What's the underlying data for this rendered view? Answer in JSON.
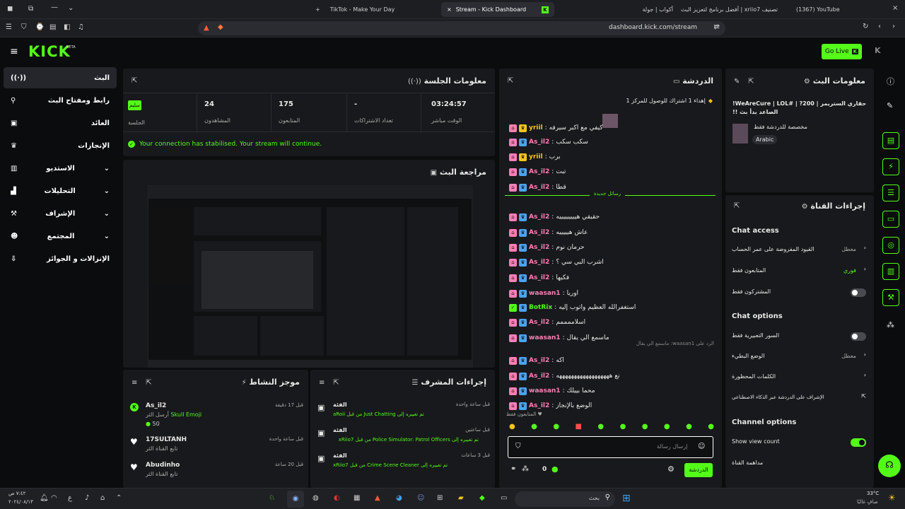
{
  "browser": {
    "tabs": [
      "(1367) YouTube",
      "تصنيف xriio7 | أفضل برنامج لتعزيز البث",
      "أكواب | جولة",
      "Stream - Kick Dashboard",
      "TikTok - Make Your Day"
    ],
    "url": "dashboard.kick.com/stream"
  },
  "header": {
    "logo": "KICK",
    "beta": "BETA",
    "go_live": "Go Live"
  },
  "sidebar": {
    "items": [
      "البث",
      "رابط ومفتاح البث",
      "العائد",
      "الإنجازات",
      "الاستديو",
      "التحليلات",
      "الإشراف",
      "المجتمع",
      "الإنزالات و الجوائز"
    ]
  },
  "session": {
    "title": "معلومات الجلسة",
    "status_badge": "سليم",
    "status_label": "الجلسة",
    "stats": [
      {
        "value": "24",
        "label": "المشاهدون"
      },
      {
        "value": "175",
        "label": "المتابعون"
      },
      {
        "value": "-",
        "label": "تعداد الاشتراكات"
      },
      {
        "value": "03:24:57",
        "label": "الوقت مباشر"
      }
    ],
    "notice": "Your connection has stabilised. Your stream will continue."
  },
  "preview": {
    "title": "مراجعة البث"
  },
  "activity": {
    "title": "موجز النشاط",
    "items": [
      {
        "user": "As_il2",
        "desc": "أرسل الثر",
        "gift": "Skull Emoji",
        "amount": "50",
        "time": "قبل 17 دقيقة"
      },
      {
        "user": "17SULTANH",
        "desc": "تابع القناة الثر",
        "time": "قبل ساعة واحدة"
      },
      {
        "user": "Abudinho",
        "desc": "تابع القناة الثر",
        "time": "قبل 20 ساعة"
      }
    ]
  },
  "mod_actions": {
    "title": "إجراءات المشرف",
    "items": [
      {
        "kind": "الفئة",
        "desc": "تم تغييره إلى Just Chatting من قبل aRoii",
        "time": "قبل ساعة واحدة"
      },
      {
        "kind": "الفئة",
        "desc": "تم تغييره إلى Police Simulator: Patrol Officers من قبل xRiio7",
        "time": "قبل ساعتين"
      },
      {
        "kind": "الفئة",
        "desc": "تم تغييره إلى Crime Scene Cleaner من قبل xRiio7",
        "time": "قبل 3 ساعات"
      }
    ]
  },
  "chat": {
    "title": "الدردشة",
    "pinned": "إهداء 1 اشتراك للوصول للمركز 1",
    "new_messages": "رسائل جديدة",
    "messages": [
      {
        "user": "yriil",
        "text": "كيفي مع اكبر سيرفه",
        "color": "#f5c518"
      },
      {
        "user": "As_il2",
        "text": "سكب سكب",
        "color": "#ff7eb6"
      },
      {
        "user": "yriil",
        "text": "برب",
        "color": "#f5c518"
      },
      {
        "user": "As_il2",
        "text": "تبت",
        "color": "#ff7eb6"
      },
      {
        "user": "As_il2",
        "text": "قطا",
        "color": "#ff7eb6"
      },
      {
        "user": "As_il2",
        "text": "حقيقي هيييييييييه",
        "color": "#ff7eb6"
      },
      {
        "user": "As_il2",
        "text": "عاش هيييييه",
        "color": "#ff7eb6"
      },
      {
        "user": "As_il2",
        "text": "حرمان نوم",
        "color": "#ff7eb6"
      },
      {
        "user": "As_il2",
        "text": "اشرب البي سي ؟",
        "color": "#ff7eb6"
      },
      {
        "user": "As_il2",
        "text": "فكيها",
        "color": "#ff7eb6"
      },
      {
        "user": "waasan1",
        "text": "اوريا",
        "color": "#ff7eb6"
      },
      {
        "user": "BotRix",
        "text": "استغفرالله العظيم واتوب إليه",
        "color": "#53fc18"
      },
      {
        "user": "As_il2",
        "text": "اسلاممممم",
        "color": "#ff7eb6"
      },
      {
        "user": "waasan1",
        "text": "ماسمع الي يقال",
        "color": "#ff7eb6"
      },
      {
        "user": "As_il2",
        "text": "اكه",
        "color": "#ff7eb6"
      },
      {
        "user": "As_il2",
        "text": "نع ههههههههههههههههههه",
        "color": "#ff7eb6"
      },
      {
        "user": "waasan1",
        "text": "محما بييلك",
        "color": "#ff7eb6"
      },
      {
        "user": "As_il2",
        "text": "الوضع بالإنجاز",
        "color": "#ff7eb6"
      }
    ],
    "reply_hint": "الرد على waasan1: ماسمع الي يقال",
    "followers_only": "المتابعون فقط",
    "placeholder": "إرسال رسالة",
    "send_label": "الدردشة",
    "count": "0"
  },
  "stream_info": {
    "title": "معلومات البث",
    "stream_title": "حقاري الستريمر | 200? | #WeAreCure | LOL! الصاعد بدأ بث !!",
    "category": "مخصصة للدردشة فقط",
    "language": "Arabic"
  },
  "channel_actions": {
    "title": "إجراءات القناة",
    "chat_access": "Chat access",
    "rows_access": [
      {
        "label": "القيود المفروضة على عمر الحساب",
        "value": "معطل"
      },
      {
        "label": "المتابعون فقط",
        "value": "فوري"
      },
      {
        "label": "المشتركون فقط",
        "value": ""
      }
    ],
    "chat_options": "Chat options",
    "rows_options": [
      {
        "label": "السور التعبيرية فقط",
        "value": ""
      },
      {
        "label": "الوضع البطيء",
        "value": "معطل"
      },
      {
        "label": "الكلمات المحظورة",
        "value": ""
      },
      {
        "label": "الإشراف على الدردشة عبر الذكاء الاصطناعي",
        "value": ""
      }
    ],
    "channel_options": "Channel options",
    "show_view_count": "Show view count",
    "raid": "مداهمة القناة"
  },
  "taskbar": {
    "weather": "33°C",
    "weather_desc": "صافٍ غالبًا",
    "search": "بحث",
    "time": "٧:٤٢ ص",
    "date": "٢٠٢٤/٠٨/١٣"
  }
}
